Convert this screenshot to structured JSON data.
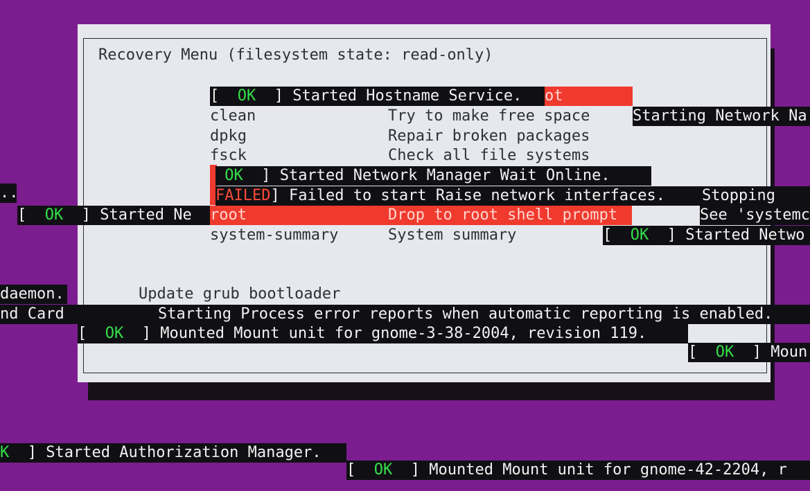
{
  "colors": {
    "background": "#7b1d8e",
    "dialog": "#e6e8ee",
    "highlight": "#f03a2e",
    "ok": "#35e04a",
    "failed": "#ff4a3a"
  },
  "recovery_menu": {
    "title": "Recovery Menu (filesystem state: read-only)",
    "items": [
      {
        "key": "clean",
        "desc": "Try to make free space"
      },
      {
        "key": "dpkg",
        "desc": "Repair broken packages"
      },
      {
        "key": "fsck",
        "desc": "Check all file systems"
      },
      {
        "key": "root",
        "desc": "Drop to root shell prompt"
      },
      {
        "key": "system-summary",
        "desc": "System summary"
      }
    ],
    "grub_desc": "Update grub bootloader",
    "partial_red": "ot"
  },
  "boot_messages": {
    "ok": "OK",
    "failed": "FAILED",
    "lb": "[",
    "rb": "]",
    "hostname": "Started Hostname Service.",
    "starting_nm": "Starting Network Na",
    "nm_wait": "Started Network Manager Wait Online.",
    "raise_failed": "Failed to start Raise network interfaces.",
    "stopping": "Stopping",
    "started_ne": "Started Ne",
    "see_systemctl": "See 'systemc",
    "started_netwo": "Started Netwo",
    "dots": "..",
    "daemon": "daemon.",
    "nd_card": "nd Card",
    "process_error": "Starting Process error reports when automatic reporting is enabled.",
    "mount_gnome338": "Mounted Mount unit for gnome-3-38-2004, revision 119.",
    "moun": "Moun",
    "k": "K",
    "authorization": "Started Authorization Manager.",
    "mount_gnome42": "Mounted Mount unit for gnome-42-2204, r"
  }
}
